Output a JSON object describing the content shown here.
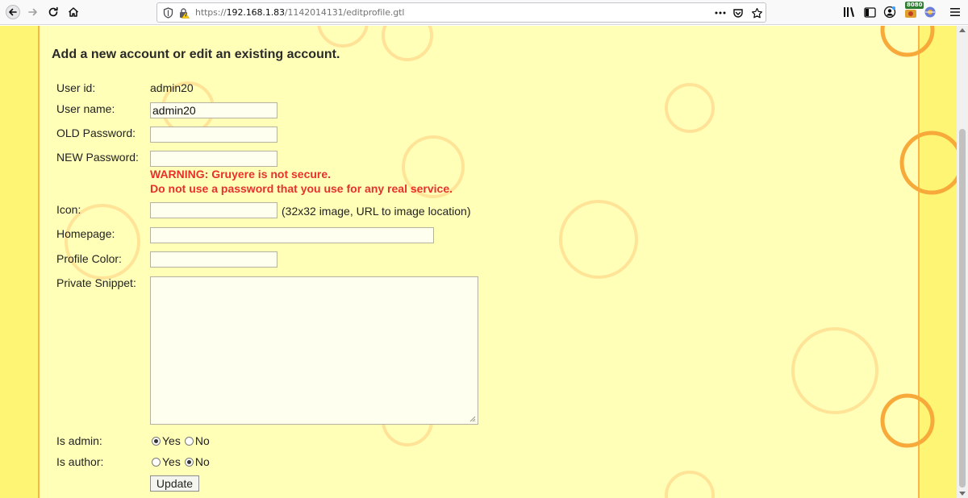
{
  "browser": {
    "url_host": "192.168.1.83",
    "url_prefix": "https://",
    "url_path": "/1142014131/editprofile.gtl",
    "ext_badge": "8080",
    "colors": {
      "toolbar": "#f9f9fa",
      "urlbar_border": "#c4c4c8"
    },
    "icons": [
      "back-icon",
      "forward-icon",
      "reload-icon",
      "home-icon",
      "shield-icon",
      "lock-warning-icon",
      "more-icon",
      "pocket-icon",
      "bookmark-star-icon",
      "library-icon",
      "sidebar-icon",
      "account-icon",
      "extension-icon",
      "extension-icon-2",
      "menu-icon"
    ]
  },
  "page": {
    "title": "Add a new account or edit an existing account.",
    "colors": {
      "page_bg": "#fdf573",
      "content_bg": "#ffffb8",
      "accent": "#f7b54a",
      "warning": "#e8302d"
    },
    "form": {
      "user_id": {
        "label": "User id:",
        "value": "admin20"
      },
      "user_name": {
        "label": "User name:",
        "value": "admin20"
      },
      "old_password": {
        "label": "OLD Password:",
        "value": ""
      },
      "new_password": {
        "label": "NEW Password:",
        "value": ""
      },
      "warning_line1": "WARNING: Gruyere is not secure.",
      "warning_line2": "Do not use a password that you use for any real service.",
      "icon": {
        "label": "Icon:",
        "value": "",
        "hint": "(32x32 image, URL to image location)"
      },
      "homepage": {
        "label": "Homepage:",
        "value": ""
      },
      "profile_color": {
        "label": "Profile Color:",
        "value": ""
      },
      "private_snippet": {
        "label": "Private Snippet:",
        "value": ""
      },
      "is_admin": {
        "label": "Is admin:",
        "options": [
          "Yes",
          "No"
        ],
        "selected": "Yes"
      },
      "is_author": {
        "label": "Is author:",
        "options": [
          "Yes",
          "No"
        ],
        "selected": "No"
      },
      "submit_label": "Update"
    }
  }
}
